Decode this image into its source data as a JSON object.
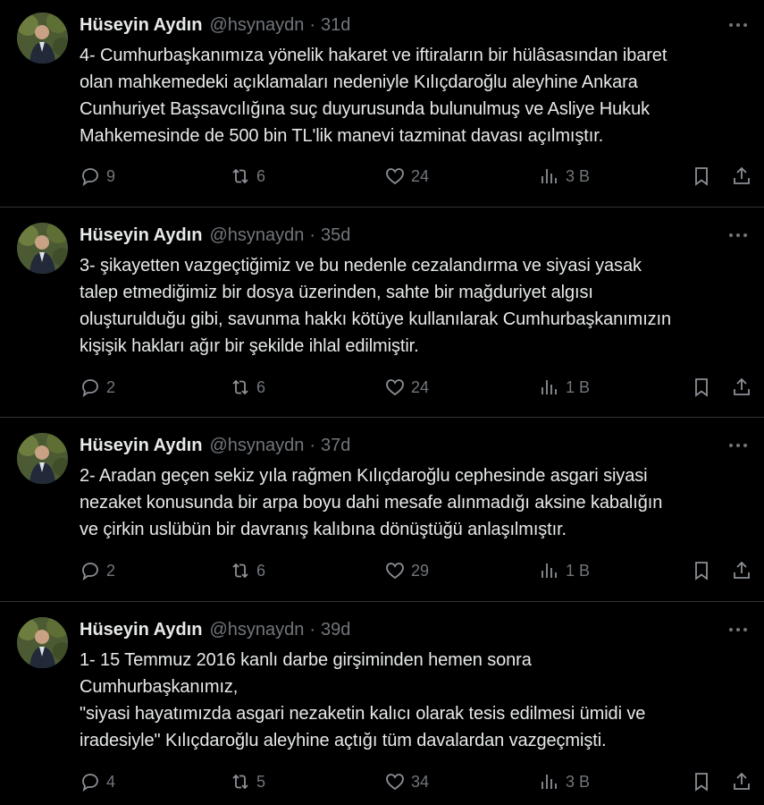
{
  "colors": {
    "background": "#000000",
    "text": "#e7e9ea",
    "muted": "#71767b",
    "divider": "#2f3336"
  },
  "tweets": [
    {
      "name": "Hüseyin Aydın",
      "handle": "@hsynaydn",
      "separator": "·",
      "time": "31d",
      "text": "4- Cumhurbaşkanımıza yönelik hakaret ve iftiraların bir hülâsasından ibaret\nolan mahkemedeki açıklamaları  nedeniyle Kılıçdaroğlu aleyhine Ankara\nCunhuriyet Başsavcılığına suç duyurusunda bulunulmuş ve Asliye Hukuk\nMahkemesinde de 500 bin TL'lik manevi tazminat davası açılmıştır.",
      "replies": "9",
      "retweets": "6",
      "likes": "24",
      "views": "3 B"
    },
    {
      "name": "Hüseyin Aydın",
      "handle": "@hsynaydn",
      "separator": "·",
      "time": "35d",
      "text": "3- şikayetten vazgeçtiğimiz ve bu nedenle cezalandırma ve siyasi yasak\ntalep etmediğimiz bir dosya üzerinden, sahte bir mağduriyet algısı\noluşturulduğu gibi, savunma hakkı kötüye kullanılarak Cumhurbaşkanımızın\nkişişik hakları ağır bir şekilde ihlal edilmiştir.",
      "replies": "2",
      "retweets": "6",
      "likes": "24",
      "views": "1 B"
    },
    {
      "name": "Hüseyin Aydın",
      "handle": "@hsynaydn",
      "separator": "·",
      "time": "37d",
      "text": "2-  Aradan geçen sekiz yıla rağmen Kılıçdaroğlu cephesinde asgari siyasi\nnezaket konusunda bir arpa boyu dahi mesafe  alınmadığı aksine kabalığın\nve çirkin uslübün bir davranış kalıbına dönüştüğü anlaşılmıştır.",
      "replies": "2",
      "retweets": "6",
      "likes": "29",
      "views": "1 B"
    },
    {
      "name": "Hüseyin Aydın",
      "handle": "@hsynaydn",
      "separator": "·",
      "time": "39d",
      "text": "1- 15 Temmuz 2016 kanlı darbe girşiminden hemen sonra\nCumhurbaşkanımız,\n\"siyasi hayatımızda asgari nezaketin kalıcı olarak tesis edilmesi ümidi ve\niradesiyle\"  Kılıçdaroğlu aleyhine açtığı tüm davalardan vazgeçmişti.",
      "replies": "4",
      "retweets": "5",
      "likes": "34",
      "views": "3 B"
    }
  ],
  "icons": {
    "reply": "speech-bubble-icon",
    "retweet": "retweet-arrows-icon",
    "like": "heart-icon",
    "views": "bar-chart-icon",
    "bookmark": "bookmark-icon",
    "share": "share-upload-icon",
    "more": "more-dots-icon"
  }
}
